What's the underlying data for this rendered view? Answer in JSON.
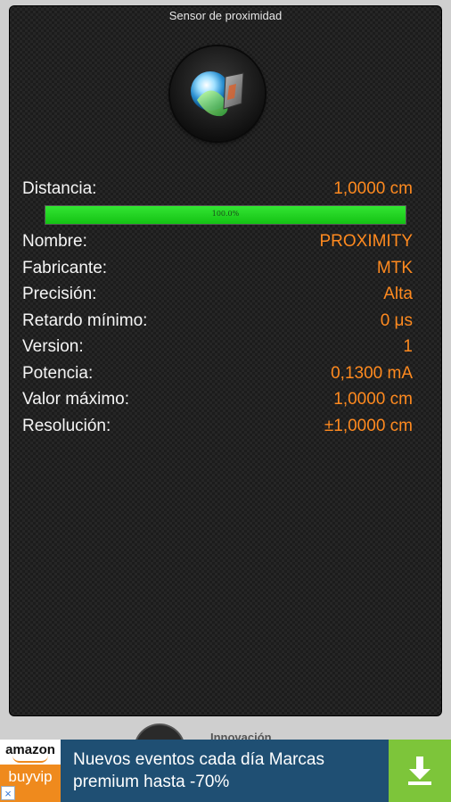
{
  "header": {
    "title": "Sensor de proximidad"
  },
  "sensor": {
    "icon": "proximity-sensor-icon"
  },
  "distance": {
    "label": "Distancia:",
    "value": "1,0000 cm",
    "progress_text": "100.0%",
    "progress_fraction": 1.0,
    "bar_color": "#1ec81e"
  },
  "properties": [
    {
      "label": "Nombre:",
      "value": "PROXIMITY"
    },
    {
      "label": "Fabricante:",
      "value": "MTK"
    },
    {
      "label": "Precisión:",
      "value": "Alta"
    },
    {
      "label": "Retardo mínimo:",
      "value": "0 μs"
    },
    {
      "label": "Version:",
      "value": "1"
    },
    {
      "label": "Potencia:",
      "value": "0,1300 mA"
    },
    {
      "label": "Valor máximo:",
      "value": "1,0000 cm"
    },
    {
      "label": "Resolución:",
      "value": "±1,0000 cm"
    }
  ],
  "colors": {
    "label": "#f5f5f5",
    "value": "#ff8a1f",
    "ad_background": "#1f4f73",
    "ad_button": "#7dc53a"
  },
  "ad": {
    "logo_top": "amazon",
    "logo_bottom": "buyvip",
    "text": "Nuevos eventos cada día Marcas premium hasta -70%",
    "close_icon": "close-icon",
    "button_icon": "download-icon",
    "close_glyph": "×"
  },
  "peek": {
    "text": "Innovación"
  }
}
